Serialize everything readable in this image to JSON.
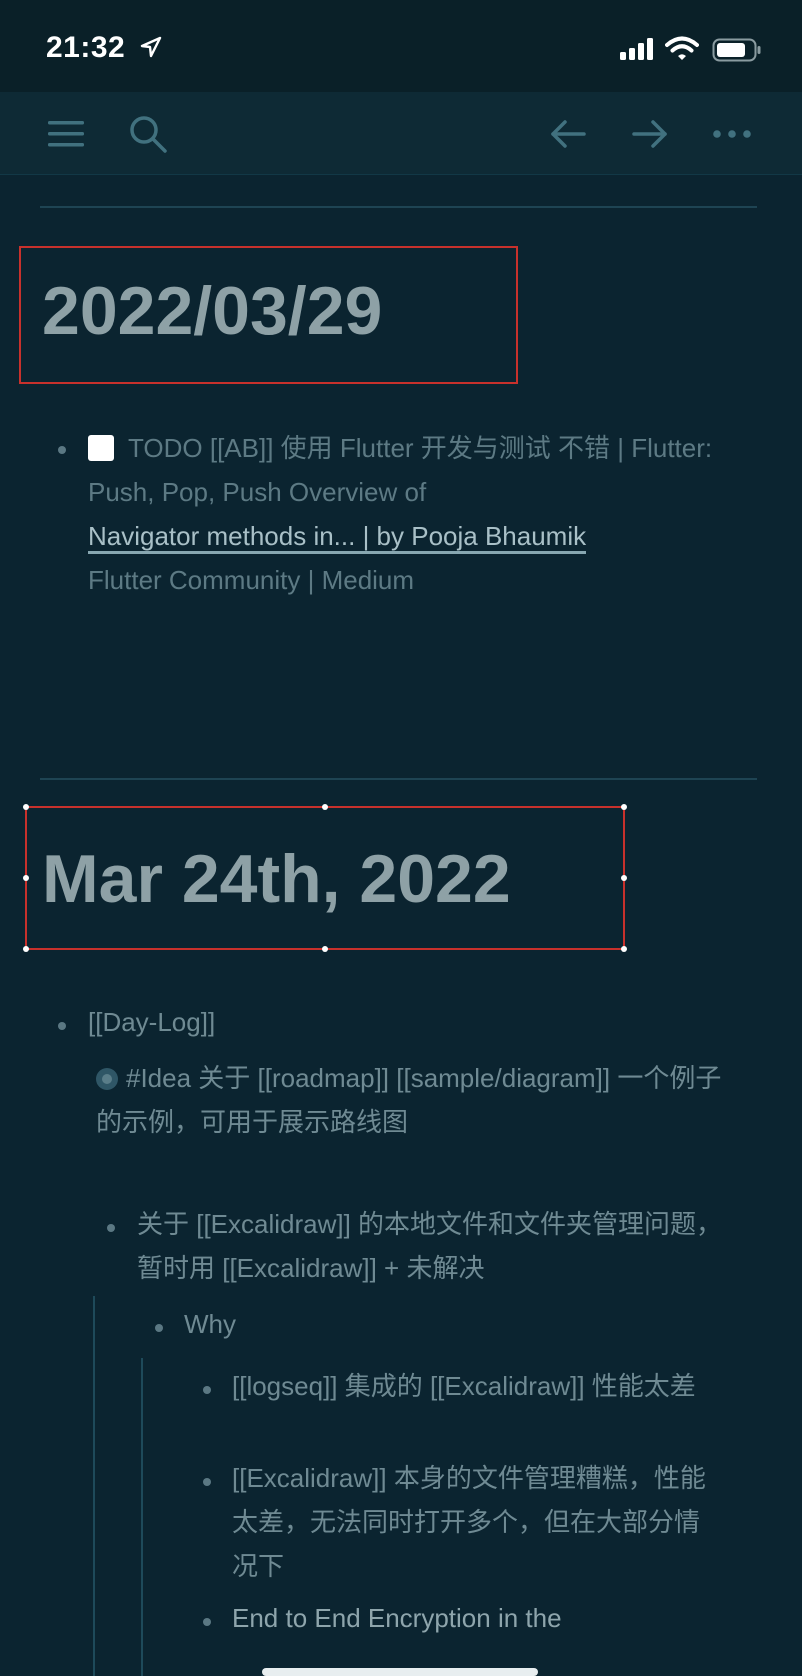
{
  "status_bar": {
    "time": "21:32"
  },
  "toolbar": {
    "icons": [
      "menu-icon",
      "search-icon",
      "back-arrow-icon",
      "forward-arrow-icon",
      "more-icon"
    ]
  },
  "sections": [
    {
      "date": "2022/03/29",
      "blocks": [
        {
          "checkbox": true,
          "text_prefix": "TODO [[AB]] 使用 Flutter 开发与测试 不错 | Flutter: Push, Pop, Push Overview of",
          "link": "Navigator methods in... | by Pooja Bhaumik",
          "text_suffix": "Flutter Community | Medium"
        }
      ]
    },
    {
      "date": "Mar 24th, 2022",
      "blocks": [
        {
          "text": "[[Day-Log]]"
        },
        {
          "text": "#Idea 关于 [[roadmap]] [[sample/diagram]] 一个例子的示例，可用于展示路线图"
        },
        {
          "text": "关于 [[Excalidraw]] 的本地文件和文件夹管理问题，暂时用 [[Excalidraw]] + 未解决"
        },
        {
          "text": "Why"
        },
        {
          "text": "[[logseq]] 集成的 [[Excalidraw]] 性能太差"
        },
        {
          "text": "[[Excalidraw]] 本身的文件管理糟糕，性能太差，无法同时打开多个，但在大部分情况下"
        },
        {
          "text": "End to End Encryption in the"
        }
      ]
    }
  ],
  "colors": {
    "background": "#0b2430",
    "selection": "#c8312c",
    "date_text": "#8ea1a6"
  }
}
